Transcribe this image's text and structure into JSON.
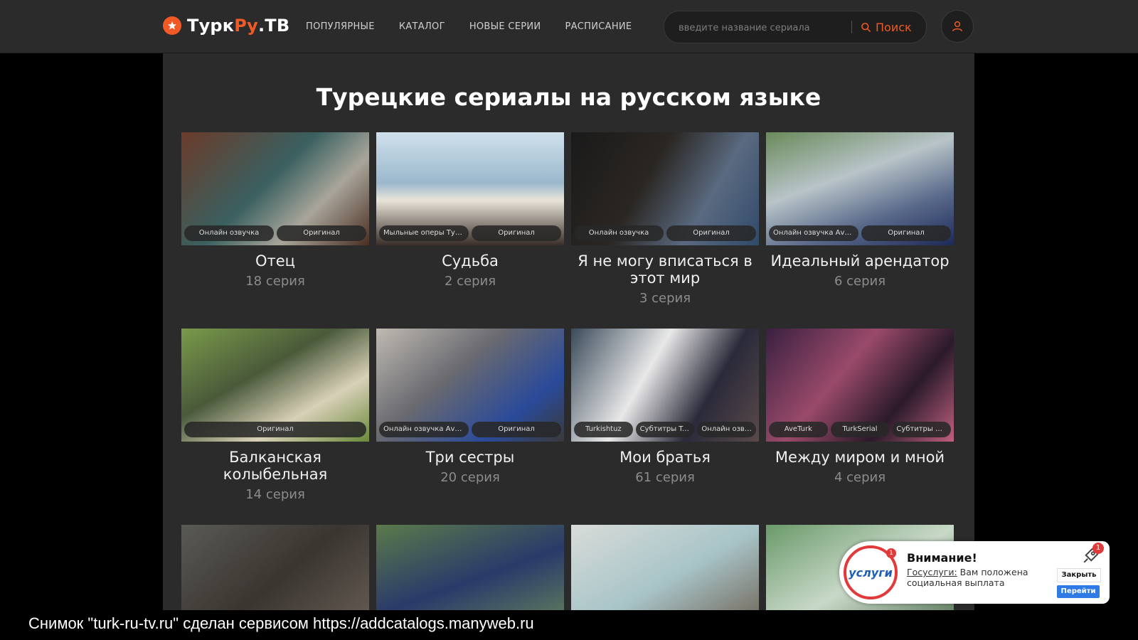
{
  "logo": {
    "part1": "Турк",
    "part2": "Ру",
    "part3": ".ТВ"
  },
  "nav": [
    "ПОПУЛЯРНЫЕ",
    "КАТАЛОГ",
    "НОВЫЕ СЕРИИ",
    "РАСПИСАНИЕ"
  ],
  "search": {
    "placeholder": "введите название сериала",
    "button": "Поиск"
  },
  "page_title": "Турецкие сериалы на русском языке",
  "cards": [
    {
      "title": "Отец",
      "episode": "18 серия",
      "badges": [
        "Онлайн озвучка",
        "Оригинал"
      ]
    },
    {
      "title": "Судьба",
      "episode": "2 серия",
      "badges": [
        "Мыльные оперы Тур...",
        "Оригинал"
      ]
    },
    {
      "title": "Я не могу вписаться в этот мир",
      "episode": "3 серия",
      "badges": [
        "Онлайн озвучка",
        "Оригинал"
      ]
    },
    {
      "title": "Идеальный арендатор",
      "episode": "6 серия",
      "badges": [
        "Онлайн озвучка Аve...",
        "Оригинал"
      ]
    },
    {
      "title": "Балканская колыбельная",
      "episode": "14 серия",
      "badges": [
        "Оригинал"
      ]
    },
    {
      "title": "Три сестры",
      "episode": "20 серия",
      "badges": [
        "Онлайн озвучка Аve...",
        "Оригинал"
      ]
    },
    {
      "title": "Мои братья",
      "episode": "61 серия",
      "badges": [
        "Turkishtuz",
        "Субтитры Tu...",
        "Онлайн озву..."
      ]
    },
    {
      "title": "Между миром и мной",
      "episode": "4 серия",
      "badges": [
        "AveTurk",
        "TurkSerial",
        "Субтитры Di..."
      ]
    },
    {
      "title": "",
      "episode": "",
      "badges": []
    },
    {
      "title": "",
      "episode": "",
      "badges": []
    },
    {
      "title": "",
      "episode": "",
      "badges": []
    },
    {
      "title": "",
      "episode": "",
      "badges": []
    }
  ],
  "notification": {
    "logo_text": "услуги",
    "logo_badge": "1",
    "title": "Внимание!",
    "link": "Госуслуги:",
    "text": " Вам положена социальная выплата",
    "badge": "1",
    "close": "Закрыть",
    "go": "Перейти"
  },
  "caption": "Снимок \"turk-ru-tv.ru\" сделан сервисом https://addcatalogs.manyweb.ru",
  "colors": {
    "accent": "#f15a24",
    "bg": "#000000",
    "panel": "#2b2b2b"
  }
}
